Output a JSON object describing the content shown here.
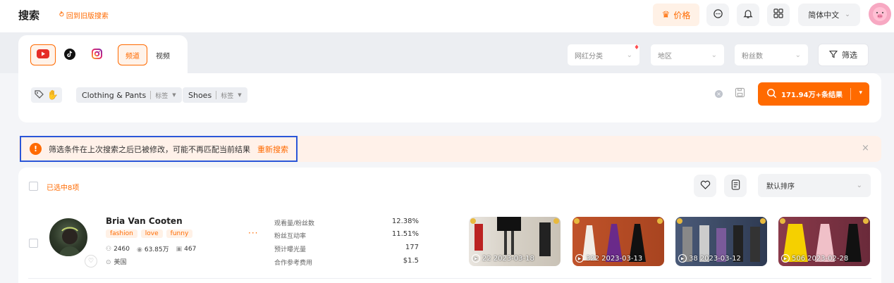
{
  "header": {
    "title": "搜索",
    "old_link": "回到旧版搜索",
    "price_label": "价格",
    "language": "简体中文"
  },
  "platforms": [
    "youtube-icon",
    "tiktok-icon",
    "instagram-icon"
  ],
  "type_tabs": {
    "channel": "频道",
    "video": "视频"
  },
  "filters": {
    "category": "网红分类",
    "region": "地区",
    "followers": "粉丝数",
    "filter_btn": "筛选"
  },
  "chips": [
    {
      "label": "Clothing & Pants",
      "sub": "标签"
    },
    {
      "label": "Shoes",
      "sub": "标签"
    }
  ],
  "search_button": "171.94万+条结果",
  "notice": {
    "text": "筛选条件在上次搜索之后已被修改，可能不再匹配当前结果",
    "action": "重新搜索"
  },
  "results": {
    "selected": "已选中8项",
    "sort": "默认排序"
  },
  "influencer": {
    "name": "Bria Van Cooten",
    "tags": [
      "fashion",
      "love",
      "funny"
    ],
    "stats": {
      "videos": "2460",
      "views": "63.85万",
      "posts": "467"
    },
    "country": "美国",
    "metrics": [
      {
        "label": "观看量/粉丝数",
        "value": "12.38%"
      },
      {
        "label": "粉丝互动率",
        "value": "11.51%"
      },
      {
        "label": "预计曝光量",
        "value": "177"
      },
      {
        "label": "合作参考费用",
        "value": "$1.5"
      }
    ],
    "videos": [
      {
        "views": "22",
        "date": "2023-03-18"
      },
      {
        "views": "322",
        "date": "2023-03-13"
      },
      {
        "views": "38",
        "date": "2023-03-12"
      },
      {
        "views": "506",
        "date": "2023-02-28"
      }
    ]
  },
  "colors": {
    "accent": "#ff6a00",
    "notice_border": "#2a56d8"
  }
}
